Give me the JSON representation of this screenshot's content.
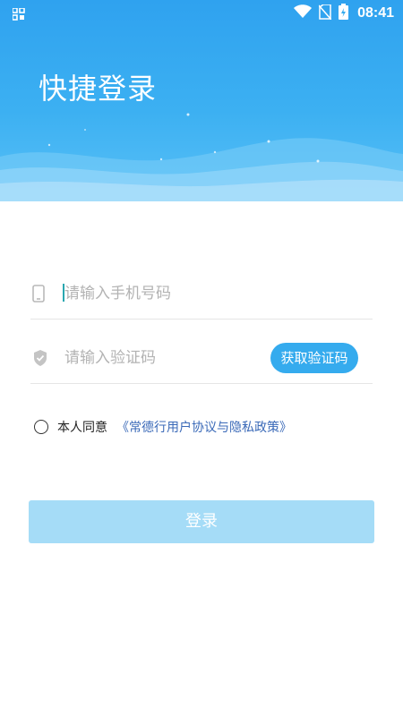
{
  "status_bar": {
    "time": "08:41",
    "icons": [
      "grid-icon",
      "wifi-icon",
      "no-sim-icon",
      "battery-charging-icon"
    ]
  },
  "header": {
    "title": "快捷登录"
  },
  "form": {
    "phone": {
      "placeholder": "请输入手机号码",
      "value": "",
      "icon": "phone-icon"
    },
    "code": {
      "placeholder": "请输入验证码",
      "value": "",
      "icon": "shield-icon"
    },
    "get_code_label": "获取验证码",
    "agree_text": "本人同意",
    "agree_link": "《常德行用户协议与隐私政策》",
    "login_label": "登录"
  },
  "colors": {
    "header_blue": "#35abee",
    "button_disabled": "#a5dcf7",
    "link": "#3b6ab8"
  }
}
